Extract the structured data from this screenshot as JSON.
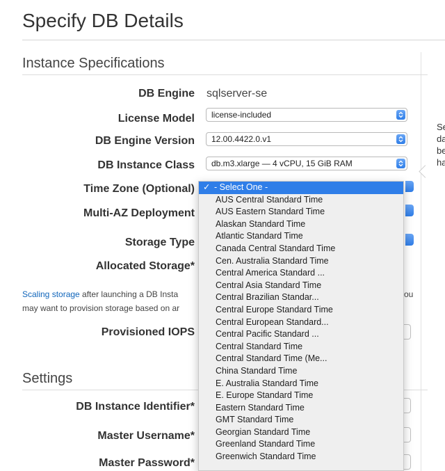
{
  "page": {
    "title": "Specify DB Details"
  },
  "sections": {
    "instance_specifications": "Instance Specifications",
    "settings": "Settings"
  },
  "fields": {
    "db_engine": {
      "label": "DB Engine",
      "value": "sqlserver-se"
    },
    "license_model": {
      "label": "License Model",
      "value": "license-included"
    },
    "engine_version": {
      "label": "DB Engine Version",
      "value": "12.00.4422.0.v1"
    },
    "instance_class": {
      "label": "DB Instance Class",
      "value": "db.m3.xlarge — 4 vCPU, 15 GiB RAM"
    },
    "time_zone": {
      "label": "Time Zone (Optional)",
      "value": "- Select One -"
    },
    "multi_az": {
      "label": "Multi-AZ Deployment"
    },
    "storage_type": {
      "label": "Storage Type"
    },
    "allocated_storage": {
      "label": "Allocated Storage*"
    },
    "provisioned_iops": {
      "label": "Provisioned IOPS"
    },
    "instance_identifier": {
      "label": "DB Instance Identifier*"
    },
    "master_username": {
      "label": "Master Username*"
    },
    "master_password": {
      "label": "Master Password*"
    }
  },
  "help": {
    "link": "Scaling storage",
    "line1_rest": " after launching a DB Insta",
    "line1_tail": "ou",
    "line2": "may want to provision storage based on ar"
  },
  "side_panel_fragments": [
    "Se",
    "da",
    "be",
    "ha"
  ],
  "time_zone_dropdown": {
    "check": "✓",
    "options": [
      "- Select One -",
      "AUS Central Standard Time",
      "AUS Eastern Standard Time",
      "Alaskan Standard Time",
      "Atlantic Standard Time",
      "Canada Central Standard Time",
      "Cen. Australia Standard Time",
      "Central America Standard ...",
      "Central Asia Standard Time",
      "Central Brazilian Standar...",
      "Central Europe Standard Time",
      "Central European Standard...",
      "Central Pacific Standard ...",
      "Central Standard Time",
      "Central Standard Time (Me...",
      "China Standard Time",
      "E. Australia Standard Time",
      "E. Europe Standard Time",
      "Eastern Standard Time",
      "GMT Standard Time",
      "Georgian Standard Time",
      "Greenland Standard Time",
      "Greenwich Standard Time"
    ]
  },
  "colors": {
    "accent": "#2f7ee8",
    "link": "#1166bb"
  },
  "icons": {
    "select_arrows": "updown-chevron-icon",
    "check": "check-icon"
  }
}
